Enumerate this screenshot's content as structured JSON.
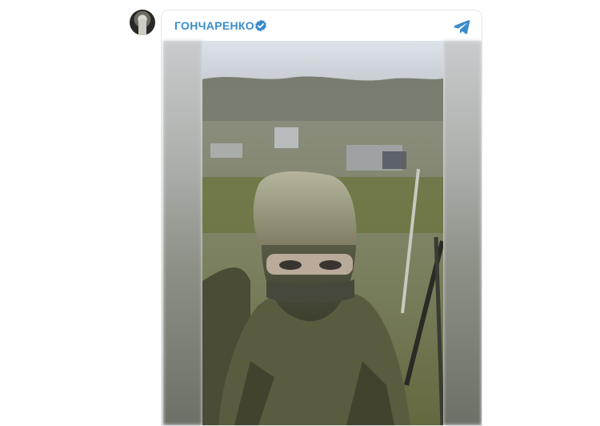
{
  "post": {
    "channel_name": "ГОНЧАРЕНКО",
    "verified_icon": "verified-badge-icon",
    "telegram_icon": "telegram-icon",
    "avatar_icon": "channel-avatar",
    "media_type": "video"
  },
  "colors": {
    "channel_name": "#3a8ccb",
    "card_border": "#e3e6e9",
    "telegram": "#3a8ccb",
    "verified": "#3a8ccb"
  }
}
